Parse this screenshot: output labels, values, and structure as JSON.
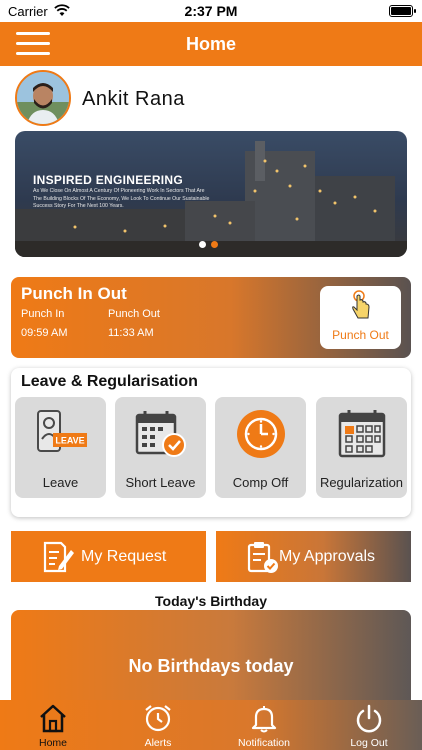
{
  "status_bar": {
    "carrier": "Carrier",
    "time": "2:37 PM"
  },
  "header": {
    "title": "Home",
    "menu_icon": "hamburger-menu-icon"
  },
  "profile": {
    "name": "Ankit  Rana"
  },
  "banner": {
    "title": "INSPIRED ENGINEERING",
    "text": "As We Close On Almost A Century Of Pioneering Work In Sectors That Are The Building Blocks Of The Economy, We Look To Continue Our Sustainable Success Story For The Next 100 Years.",
    "active_slide": 2,
    "slide_count": 2
  },
  "punch": {
    "title": "Punch In Out",
    "punch_in_label": "Punch In",
    "punch_in_time": "09:59 AM",
    "punch_out_label": "Punch Out",
    "punch_out_time": "11:33 AM",
    "button_label": "Punch Out",
    "button_icon": "touch-hand-icon"
  },
  "leave_section": {
    "title": "Leave & Regularisation",
    "tiles": [
      {
        "label": "Leave",
        "icon": "leave-form-icon",
        "badge": "LEAVE"
      },
      {
        "label": "Short Leave",
        "icon": "calendar-check-icon"
      },
      {
        "label": "Comp Off",
        "icon": "clock-icon"
      },
      {
        "label": "Regularization",
        "icon": "calendar-grid-icon"
      }
    ]
  },
  "actions": {
    "my_request": "My Request",
    "my_approvals": "My Approvals"
  },
  "birthday": {
    "title": "Today's Birthday",
    "message": "No Birthdays today"
  },
  "bottom_nav": [
    {
      "label": "Home",
      "icon": "home-icon"
    },
    {
      "label": "Alerts",
      "icon": "alarm-clock-icon"
    },
    {
      "label": "Notification",
      "icon": "bell-icon"
    },
    {
      "label": "Log Out",
      "icon": "power-icon"
    }
  ],
  "colors": {
    "accent": "#ef7a16",
    "dark": "#5a5250",
    "tile_bg": "#dadada"
  }
}
